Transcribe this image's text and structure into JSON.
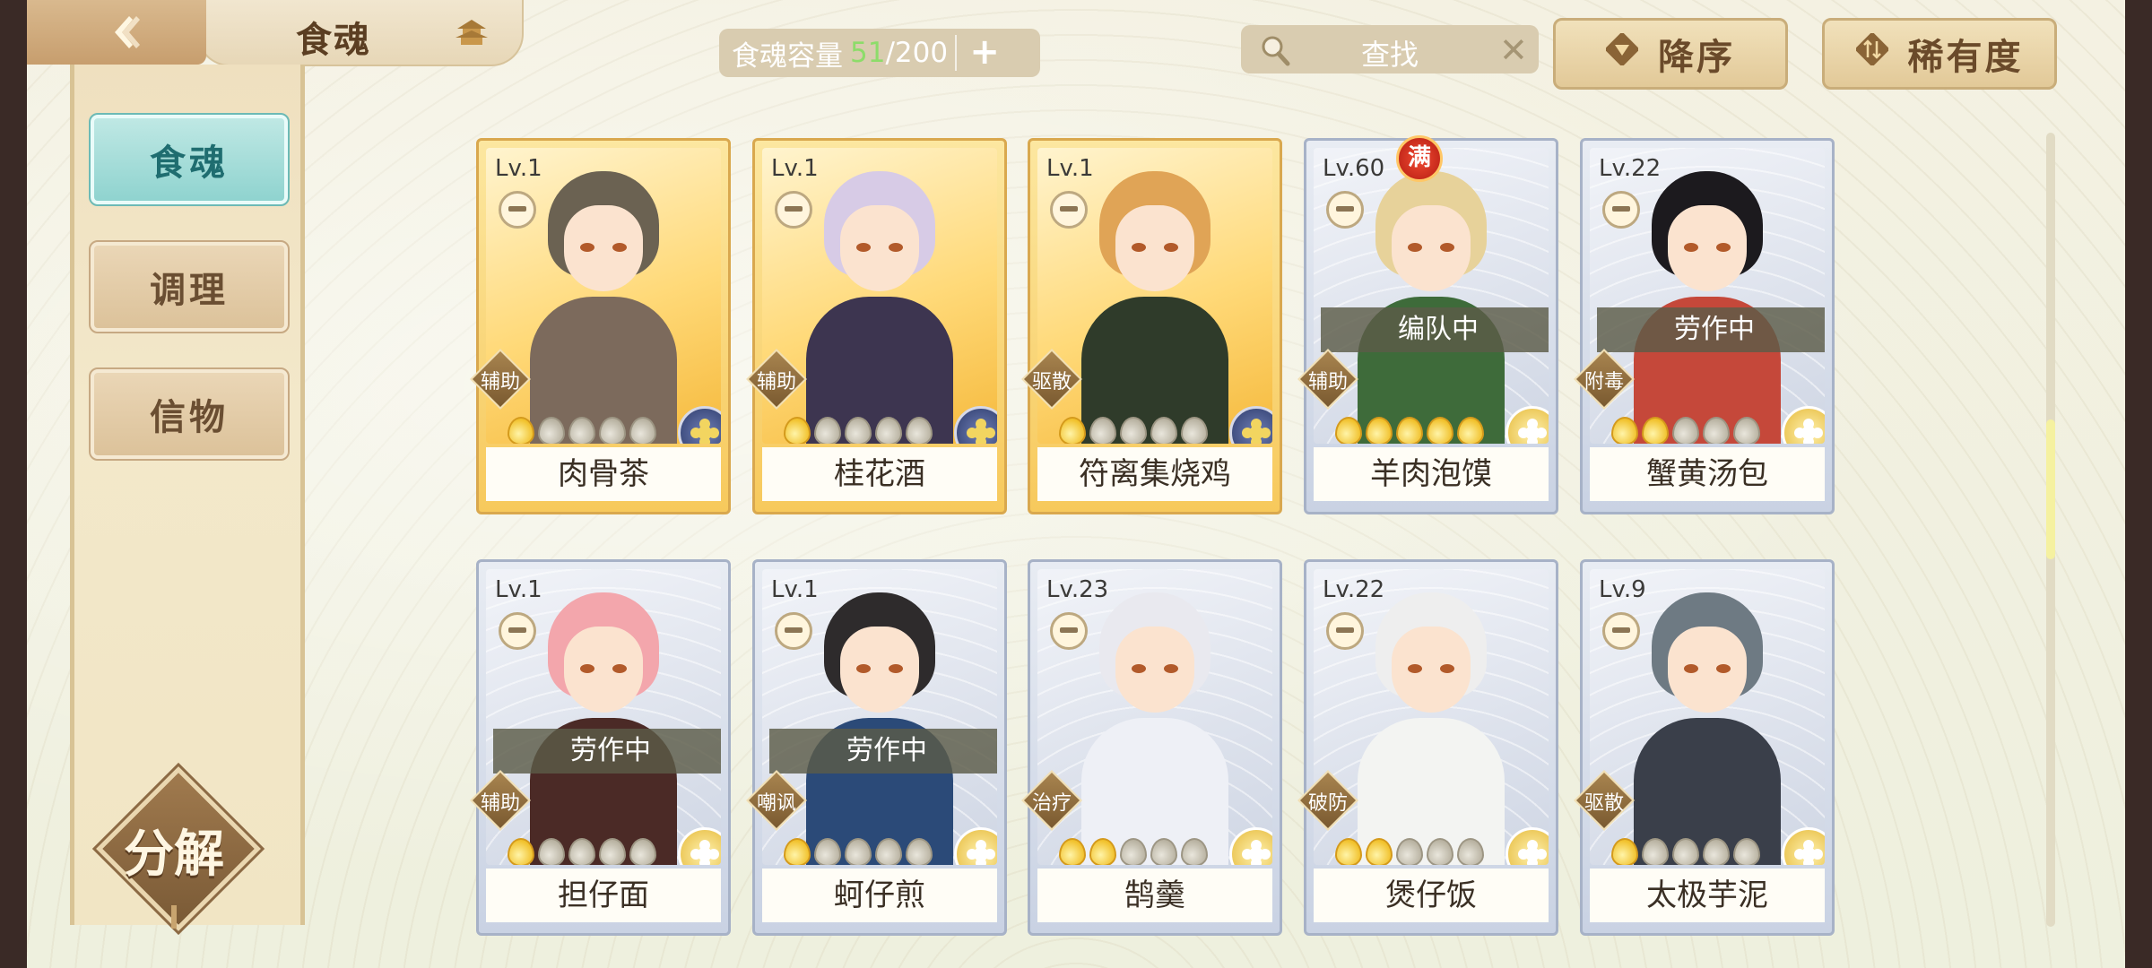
{
  "header": {
    "title": "食魂",
    "back_icon": "back-arrow-icon",
    "home_icon": "pagoda-icon"
  },
  "sidebar": {
    "items": [
      {
        "label": "食魂",
        "active": true
      },
      {
        "label": "调理",
        "active": false
      },
      {
        "label": "信物",
        "active": false
      }
    ],
    "decompose_label": "分解"
  },
  "capacity": {
    "label": "食魂容量",
    "used": "51",
    "total": "/200",
    "add_icon": "plus-icon"
  },
  "search": {
    "placeholder": "查找",
    "clear_icon": "close-icon"
  },
  "sort": {
    "order_label": "降序",
    "rarity_label": "稀有度"
  },
  "colors": {
    "accent_teal": "#8fd3cf",
    "capacity_green": "#8ddc6a",
    "gold_card": "#f7c95c",
    "silver_card": "#c9d2e3"
  },
  "cards": [
    {
      "name": "肉骨茶",
      "level": "Lv.1",
      "role": "辅助",
      "rarity": "gold",
      "stars_on": 1,
      "badge": "blue",
      "status": "",
      "hair": "#6b6252",
      "outfit": "#7c6a5c",
      "max": ""
    },
    {
      "name": "桂花酒",
      "level": "Lv.1",
      "role": "辅助",
      "rarity": "gold",
      "stars_on": 1,
      "badge": "blue",
      "status": "",
      "hair": "#d7cbe6",
      "outfit": "#3d3550",
      "max": ""
    },
    {
      "name": "符离集烧鸡",
      "level": "Lv.1",
      "role": "驱散",
      "rarity": "gold",
      "stars_on": 1,
      "badge": "blue",
      "status": "",
      "hair": "#e0a456",
      "outfit": "#2f3b2a",
      "max": ""
    },
    {
      "name": "羊肉泡馍",
      "level": "Lv.60",
      "role": "辅助",
      "rarity": "silver",
      "stars_on": 5,
      "badge": "gold",
      "status": "编队中",
      "hair": "#e7d29a",
      "outfit": "#3e6b3a",
      "max": "满"
    },
    {
      "name": "蟹黄汤包",
      "level": "Lv.22",
      "role": "附毒",
      "rarity": "silver",
      "stars_on": 2,
      "badge": "gold",
      "status": "劳作中",
      "hair": "#1c1a1e",
      "outfit": "#c5483a",
      "max": ""
    },
    {
      "name": "担仔面",
      "level": "Lv.1",
      "role": "辅助",
      "rarity": "silver",
      "stars_on": 1,
      "badge": "gold",
      "status": "劳作中",
      "hair": "#f3a6ac",
      "outfit": "#4b2a26",
      "max": ""
    },
    {
      "name": "蚵仔煎",
      "level": "Lv.1",
      "role": "嘲讽",
      "rarity": "silver",
      "stars_on": 1,
      "badge": "gold",
      "status": "劳作中",
      "hair": "#2e2b2c",
      "outfit": "#2b4a78",
      "max": ""
    },
    {
      "name": "鹄羹",
      "level": "Lv.23",
      "role": "治疗",
      "rarity": "silver",
      "stars_on": 2,
      "badge": "gold",
      "status": "",
      "hair": "#e9e9ef",
      "outfit": "#eef0f6",
      "max": ""
    },
    {
      "name": "煲仔饭",
      "level": "Lv.22",
      "role": "破防",
      "rarity": "silver",
      "stars_on": 2,
      "badge": "gold",
      "status": "",
      "hair": "#eeeeee",
      "outfit": "#f3f4f2",
      "max": ""
    },
    {
      "name": "太极芋泥",
      "level": "Lv.9",
      "role": "驱散",
      "rarity": "silver",
      "stars_on": 1,
      "badge": "gold",
      "status": "",
      "hair": "#6e7a83",
      "outfit": "#3a3f4a",
      "max": ""
    }
  ]
}
